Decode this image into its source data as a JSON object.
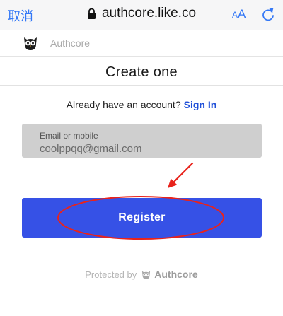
{
  "browser": {
    "cancel_label": "取消",
    "url": "authcore.like.co",
    "text_size_large": "A",
    "text_size_small": "A"
  },
  "header": {
    "brand": "Authcore"
  },
  "page": {
    "title": "Create one",
    "signin_prompt": "Already have an account?",
    "signin_link": "Sign In"
  },
  "form": {
    "field_label": "Email or mobile",
    "field_value": "coolppqq@gmail.com",
    "register_label": "Register"
  },
  "footer": {
    "protected_by": "Protected by",
    "brand": "Authcore"
  },
  "colors": {
    "accent": "#3651e6",
    "link": "#1f4fd8",
    "browser_blue": "#3478f6",
    "annotation_red": "#e8231c"
  }
}
